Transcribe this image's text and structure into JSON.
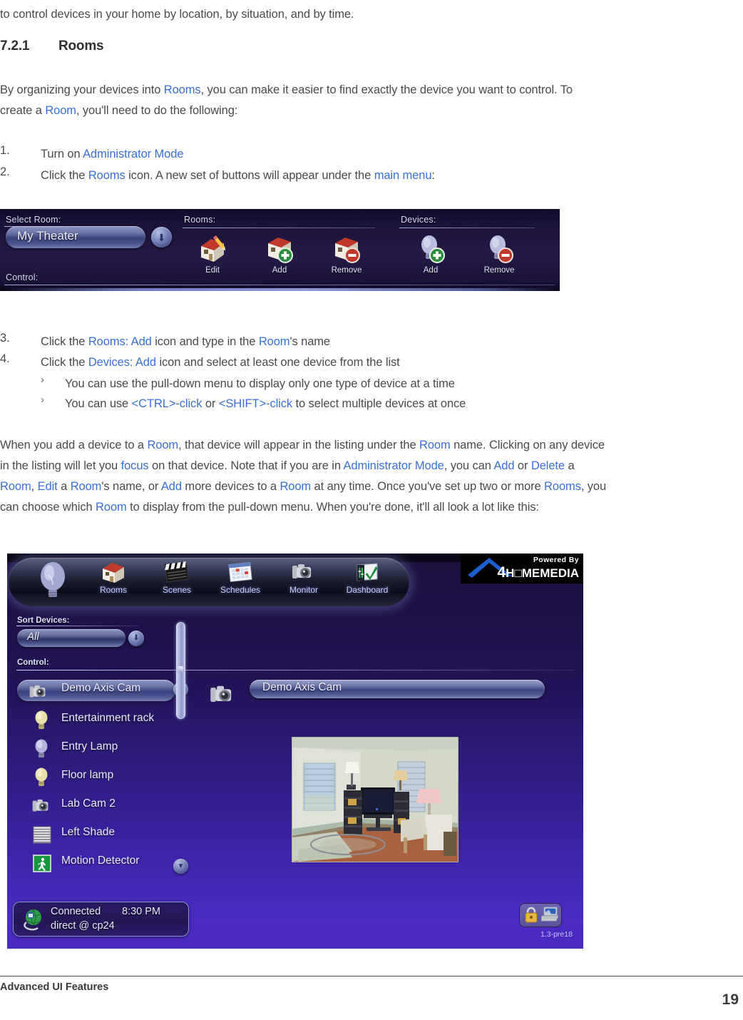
{
  "document": {
    "intro_line": "to control devices in your home by location, by situation, and by time.",
    "section": {
      "number": "7.2.1",
      "title": "Rooms"
    },
    "paragraph1": [
      {
        "t": "By organizing your devices into "
      },
      {
        "t": "Rooms",
        "k": true
      },
      {
        "t": ", you can make it easier to find exactly the device you want to control. To"
      }
    ],
    "paragraph1b": [
      {
        "t": "create a "
      },
      {
        "t": "Room",
        "k": true
      },
      {
        "t": ", you'll need to do the following:"
      }
    ],
    "steps_top": [
      {
        "num": "1.",
        "parts": [
          {
            "t": "Turn on "
          },
          {
            "t": "Administrator Mode",
            "k": true
          }
        ]
      },
      {
        "num": "2.",
        "parts": [
          {
            "t": "Click the "
          },
          {
            "t": "Rooms",
            "k": true
          },
          {
            "t": " icon. A new set of buttons will appear under the "
          },
          {
            "t": "main menu",
            "k": true
          },
          {
            "t": ":"
          }
        ]
      }
    ],
    "steps_bottom": [
      {
        "num": "3.",
        "parts": [
          {
            "t": "Click the "
          },
          {
            "t": "Rooms: Add",
            "k": true
          },
          {
            "t": " icon and type in the "
          },
          {
            "t": "Room",
            "k": true
          },
          {
            "t": "'s name"
          }
        ]
      },
      {
        "num": "4.",
        "parts": [
          {
            "t": "Click the "
          },
          {
            "t": "Devices: Add",
            "k": true
          },
          {
            "t": " icon and select at least one device from the list"
          }
        ]
      }
    ],
    "sub_bullets": [
      {
        "marker": "›",
        "parts": [
          {
            "t": "You can use the pull-down menu to display only one type of device at a time"
          }
        ]
      },
      {
        "marker": "›",
        "parts": [
          {
            "t": "You can use "
          },
          {
            "t": "<CTRL>-click",
            "k": true
          },
          {
            "t": " or "
          },
          {
            "t": "<SHIFT>-click",
            "k": true
          },
          {
            "t": " to select multiple devices at once"
          }
        ]
      }
    ],
    "paragraph2": [
      [
        {
          "t": "When you add a device to a "
        },
        {
          "t": "Room",
          "k": true
        },
        {
          "t": ", that device will appear in the listing under the "
        },
        {
          "t": "Room",
          "k": true
        },
        {
          "t": " name. Clicking on any device"
        }
      ],
      [
        {
          "t": "in the listing will let you "
        },
        {
          "t": "focus",
          "k": true
        },
        {
          "t": " on that device. Note that if you are in "
        },
        {
          "t": "Administrator Mode",
          "k": true
        },
        {
          "t": ", you can "
        },
        {
          "t": "Add",
          "k": true
        },
        {
          "t": " or "
        },
        {
          "t": "Delete",
          "k": true
        },
        {
          "t": " a"
        }
      ],
      [
        {
          "t": "Room",
          "k": true
        },
        {
          "t": ", "
        },
        {
          "t": "Edit",
          "k": true
        },
        {
          "t": " a "
        },
        {
          "t": "Room",
          "k": true
        },
        {
          "t": "'s name, or "
        },
        {
          "t": "Add",
          "k": true
        },
        {
          "t": " more devices to a "
        },
        {
          "t": "Room",
          "k": true
        },
        {
          "t": " at any time. Once you've set up two or more "
        },
        {
          "t": "Rooms",
          "k": true
        },
        {
          "t": ", you"
        }
      ],
      [
        {
          "t": "can choose which "
        },
        {
          "t": "Room",
          "k": true
        },
        {
          "t": " to display from the pull-down menu. When you're done, it'll all look a lot like this:"
        }
      ]
    ],
    "footer": {
      "left": "Advanced UI Features",
      "page_number": "19"
    }
  },
  "screenshot_toolbar": {
    "labels": {
      "select_room": "Select Room:",
      "control": "Control:",
      "rooms": "Rooms:",
      "devices": "Devices:"
    },
    "room_combo_value": "My Theater",
    "room_combo_icon": "down-arrow-icon",
    "rooms_actions": [
      {
        "label": "Edit",
        "icon": "house-edit-icon"
      },
      {
        "label": "Add",
        "icon": "house-add-icon"
      },
      {
        "label": "Remove",
        "icon": "house-remove-icon"
      }
    ],
    "devices_actions": [
      {
        "label": "Add",
        "icon": "bulb-add-icon"
      },
      {
        "label": "Remove",
        "icon": "bulb-remove-icon"
      }
    ]
  },
  "screenshot_main": {
    "brand": {
      "powered_by": "Powered By",
      "name_4": "4",
      "name_rest": "H□ME",
      "name_media": "MEDIA",
      "full": "4H□MEMEDIA"
    },
    "nav_items": [
      {
        "label": "Rooms",
        "icon": "house-icon"
      },
      {
        "label": "Scenes",
        "icon": "clapperboard-icon"
      },
      {
        "label": "Schedules",
        "icon": "calendar-icon"
      },
      {
        "label": "Monitor",
        "icon": "camera-icon"
      },
      {
        "label": "Dashboard",
        "icon": "dashboard-check-icon"
      }
    ],
    "sort_label": "Sort Devices:",
    "sort_value": "All",
    "sort_icon": "down-arrow-icon",
    "control_label": "Control:",
    "devices": [
      {
        "name": "Demo Axis Cam",
        "icon": "camera-icon",
        "selected": true
      },
      {
        "name": "Entertainment rack",
        "icon": "bulb-yellow-icon",
        "selected": false
      },
      {
        "name": "Entry Lamp",
        "icon": "bulb-purple-icon",
        "selected": false
      },
      {
        "name": "Floor lamp",
        "icon": "bulb-yellow-icon",
        "selected": false
      },
      {
        "name": "Lab Cam 2",
        "icon": "camera-icon",
        "selected": false
      },
      {
        "name": "Left Shade",
        "icon": "blinds-icon",
        "selected": false
      },
      {
        "name": "Motion Detector",
        "icon": "motion-detector-icon",
        "selected": false
      }
    ],
    "scroll_up_icon": "scroll-up-icon",
    "scroll_down_icon": "scroll-down-icon",
    "detail": {
      "title": "Demo Axis Cam",
      "icon": "camera-icon",
      "video_alt": "living room camera view"
    },
    "status": {
      "connection": "Connected",
      "host": "direct @ cp24",
      "time": "8:30 PM",
      "icon": "globe-icon"
    },
    "tray": {
      "lock_icon": "padlock-icon",
      "device_icon": "laptop-icon"
    },
    "version": "1.3-pre18"
  },
  "colors": {
    "keyword_blue": "#3b6fd4",
    "body_gray": "#4a4a4a",
    "panel_dark": "#1b0f3b",
    "panel_bright": "#4a2abf",
    "toolbar_navy": "#1b1238"
  }
}
